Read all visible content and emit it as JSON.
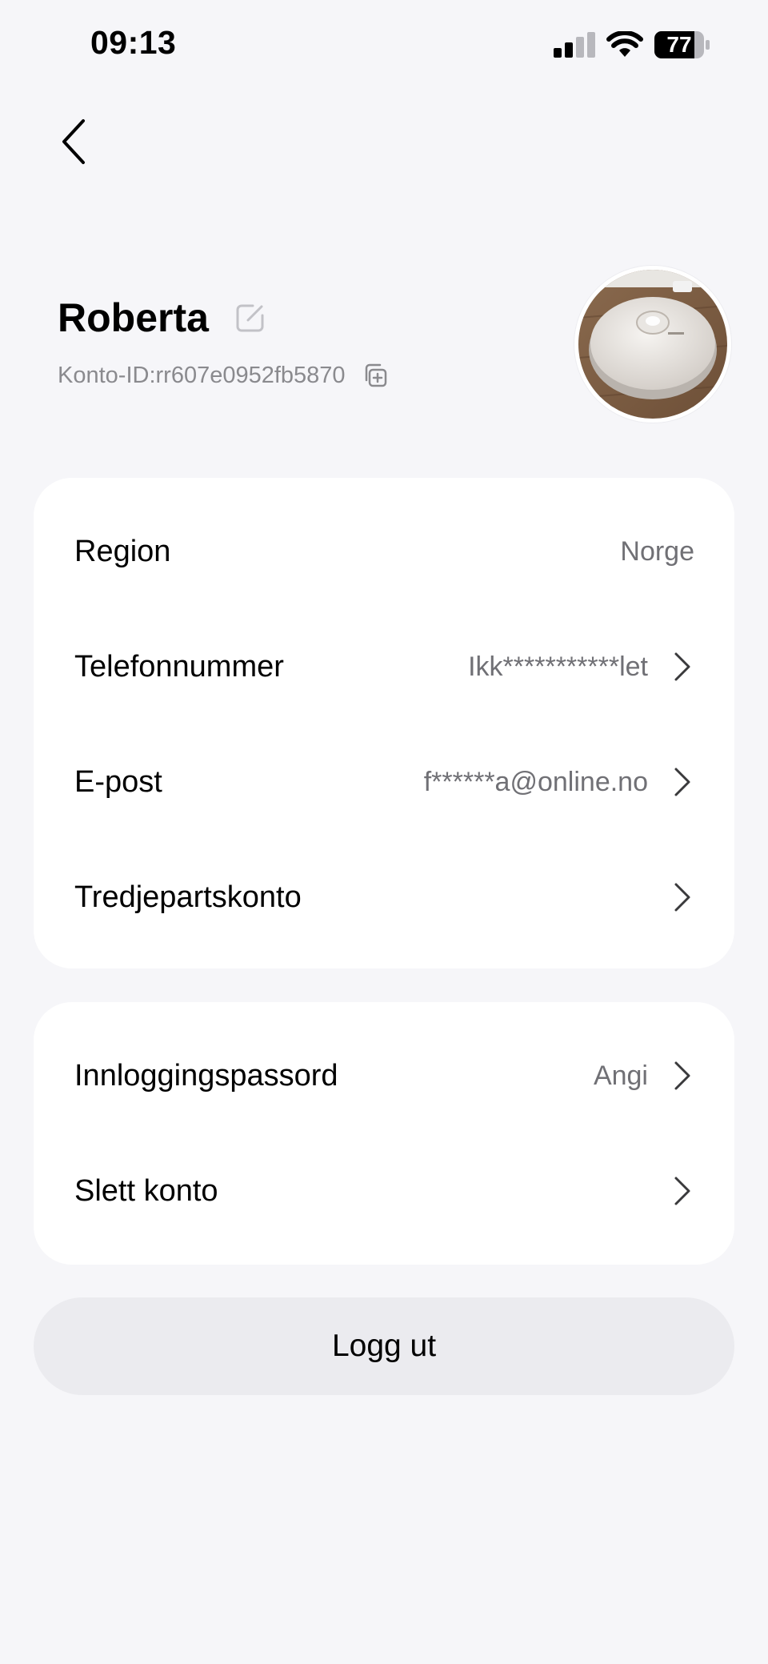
{
  "status_bar": {
    "time": "09:13",
    "battery": "77",
    "icons": [
      "signal-icon",
      "wifi-icon",
      "battery-icon"
    ]
  },
  "header": {
    "back_icon": "chevron-left-icon"
  },
  "profile": {
    "name": "Roberta",
    "account_id": "Konto-ID:rr607e0952fb5870",
    "edit_icon": "edit-icon",
    "copy_icon": "copy-icon",
    "avatar": "robot-vacuum-photo"
  },
  "account_card": {
    "rows": [
      {
        "label": "Region",
        "value": "Norge"
      },
      {
        "label": "Telefonnummer",
        "value": "Ikk***********let"
      },
      {
        "label": "E-post",
        "value": "f******a@online.no"
      },
      {
        "label": "Tredjepartskonto",
        "value": ""
      }
    ]
  },
  "security_card": {
    "rows": [
      {
        "label": "Innloggingspassord",
        "value": "Angi"
      },
      {
        "label": "Slett konto",
        "value": ""
      }
    ]
  },
  "logout": {
    "label": "Logg ut"
  },
  "colors": {
    "background": "#f6f6f9",
    "card": "#ffffff",
    "secondary_text": "#707075",
    "muted_text": "#8a8a8e",
    "logout_button": "#ebebef"
  }
}
